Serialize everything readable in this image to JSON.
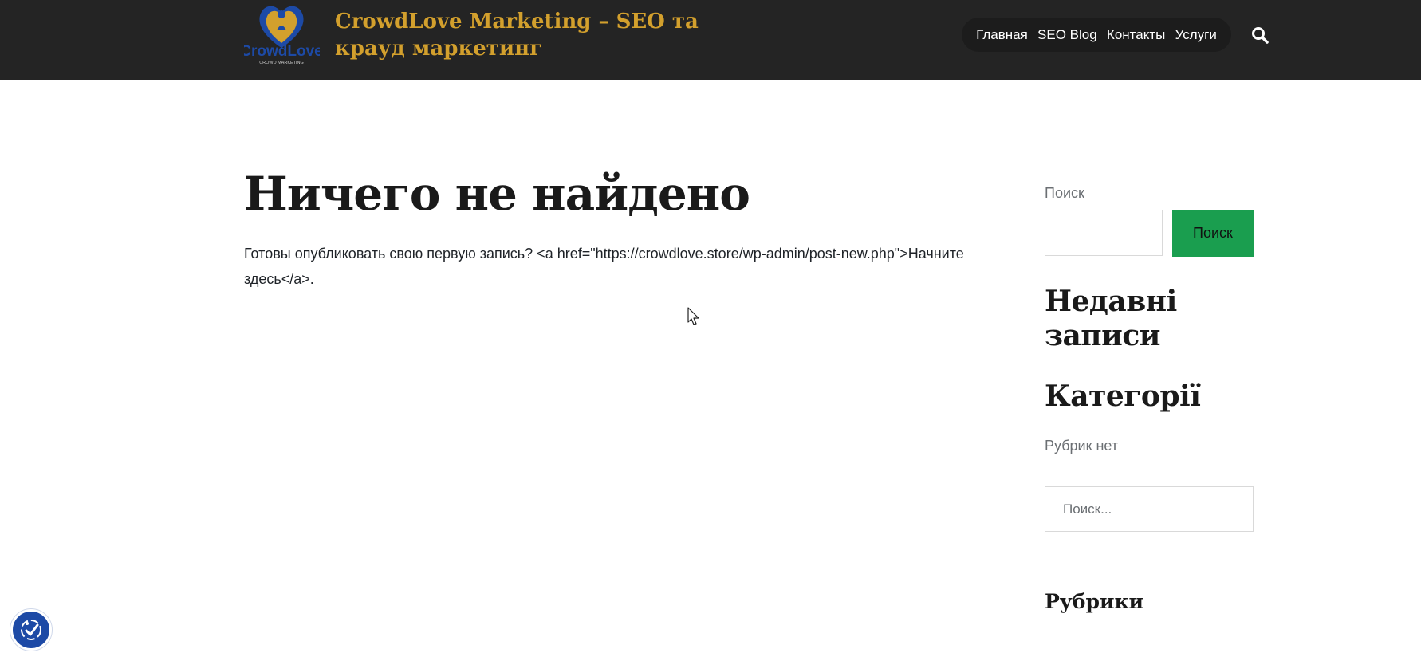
{
  "header": {
    "site_title": "CrowdLove Marketing – SEO та крауд маркетинг",
    "logo_text": "CrowdLove",
    "logo_subtext": "CROWD MARKETING",
    "nav": [
      {
        "label": "Главная"
      },
      {
        "label": "SEO Blog"
      },
      {
        "label": "Контакты"
      },
      {
        "label": "Услуги"
      }
    ],
    "search_icon": "search-icon"
  },
  "main": {
    "title": "Ничего не найдено",
    "body": "Готовы опубликовать свою первую запись? <a href=\"https://crowdlove.store/wp-admin/post-new.php\">Начните здесь</a>."
  },
  "sidebar": {
    "search_label": "Поиск",
    "search_button": "Поиск",
    "recent_posts_title": "Недавні записи",
    "categories_title": "Категорії",
    "no_categories": "Рубрик нет",
    "search_placeholder": "Поиск...",
    "rubrics_title": "Рубрики"
  },
  "colors": {
    "header_bg": "#242424",
    "title_gold": "#d3a02d",
    "button_green": "#1a9e4f",
    "accessibility_blue": "#1d4aa6"
  }
}
